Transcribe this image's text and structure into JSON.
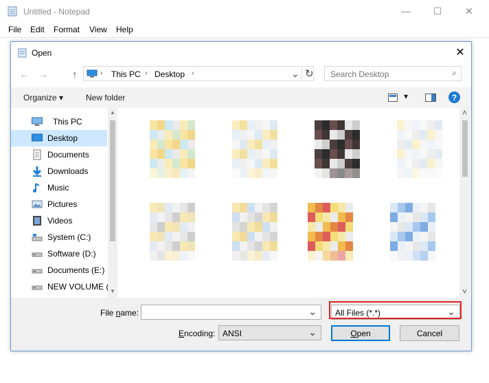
{
  "notepad": {
    "title": "Untitled - Notepad",
    "menu": [
      "File",
      "Edit",
      "Format",
      "View",
      "Help"
    ],
    "caption": {
      "minimize": "—",
      "maximize": "☐",
      "close": "✕"
    }
  },
  "dialog": {
    "title": "Open",
    "close_glyph": "✕",
    "nav": {
      "back": "←",
      "forward": "→",
      "up": "↑",
      "refresh": "↻"
    },
    "address": {
      "crumbs": [
        "This PC",
        "Desktop"
      ],
      "sep": "›",
      "dropdown": "⌄"
    },
    "search": {
      "placeholder": "Search Desktop",
      "icon": "⌕"
    },
    "toolbar": {
      "organize": "Organize ▾",
      "new_folder": "New folder",
      "view_arrow": "▾",
      "help": "?"
    },
    "sidebar": [
      {
        "label": "This PC",
        "icon": "computer-icon"
      },
      {
        "label": "Desktop",
        "icon": "desktop-icon",
        "selected": true
      },
      {
        "label": "Documents",
        "icon": "documents-icon"
      },
      {
        "label": "Downloads",
        "icon": "downloads-icon"
      },
      {
        "label": "Music",
        "icon": "music-icon"
      },
      {
        "label": "Pictures",
        "icon": "pictures-icon"
      },
      {
        "label": "Videos",
        "icon": "videos-icon"
      },
      {
        "label": "System (C:)",
        "icon": "drive-icon"
      },
      {
        "label": "Software (D:)",
        "icon": "drive-icon"
      },
      {
        "label": "Documents (E:)",
        "icon": "drive-icon"
      },
      {
        "label": "NEW VOLUME (F",
        "icon": "drive-icon"
      }
    ],
    "scroll": {
      "up": "▲",
      "down": "▼",
      "up_main": "˄",
      "down_main": "˅"
    },
    "bottom": {
      "file_name_label": "File name:",
      "file_name_value": "",
      "file_type": "All Files  (*.*)",
      "encoding_label": "Encoding:",
      "encoding_value": "ANSI",
      "open": "Open",
      "cancel": "Cancel",
      "dropdown": "⌄"
    },
    "colors": {
      "selected": "#cde8ff",
      "accent": "#0078d7",
      "highlight": "#e02424"
    }
  }
}
